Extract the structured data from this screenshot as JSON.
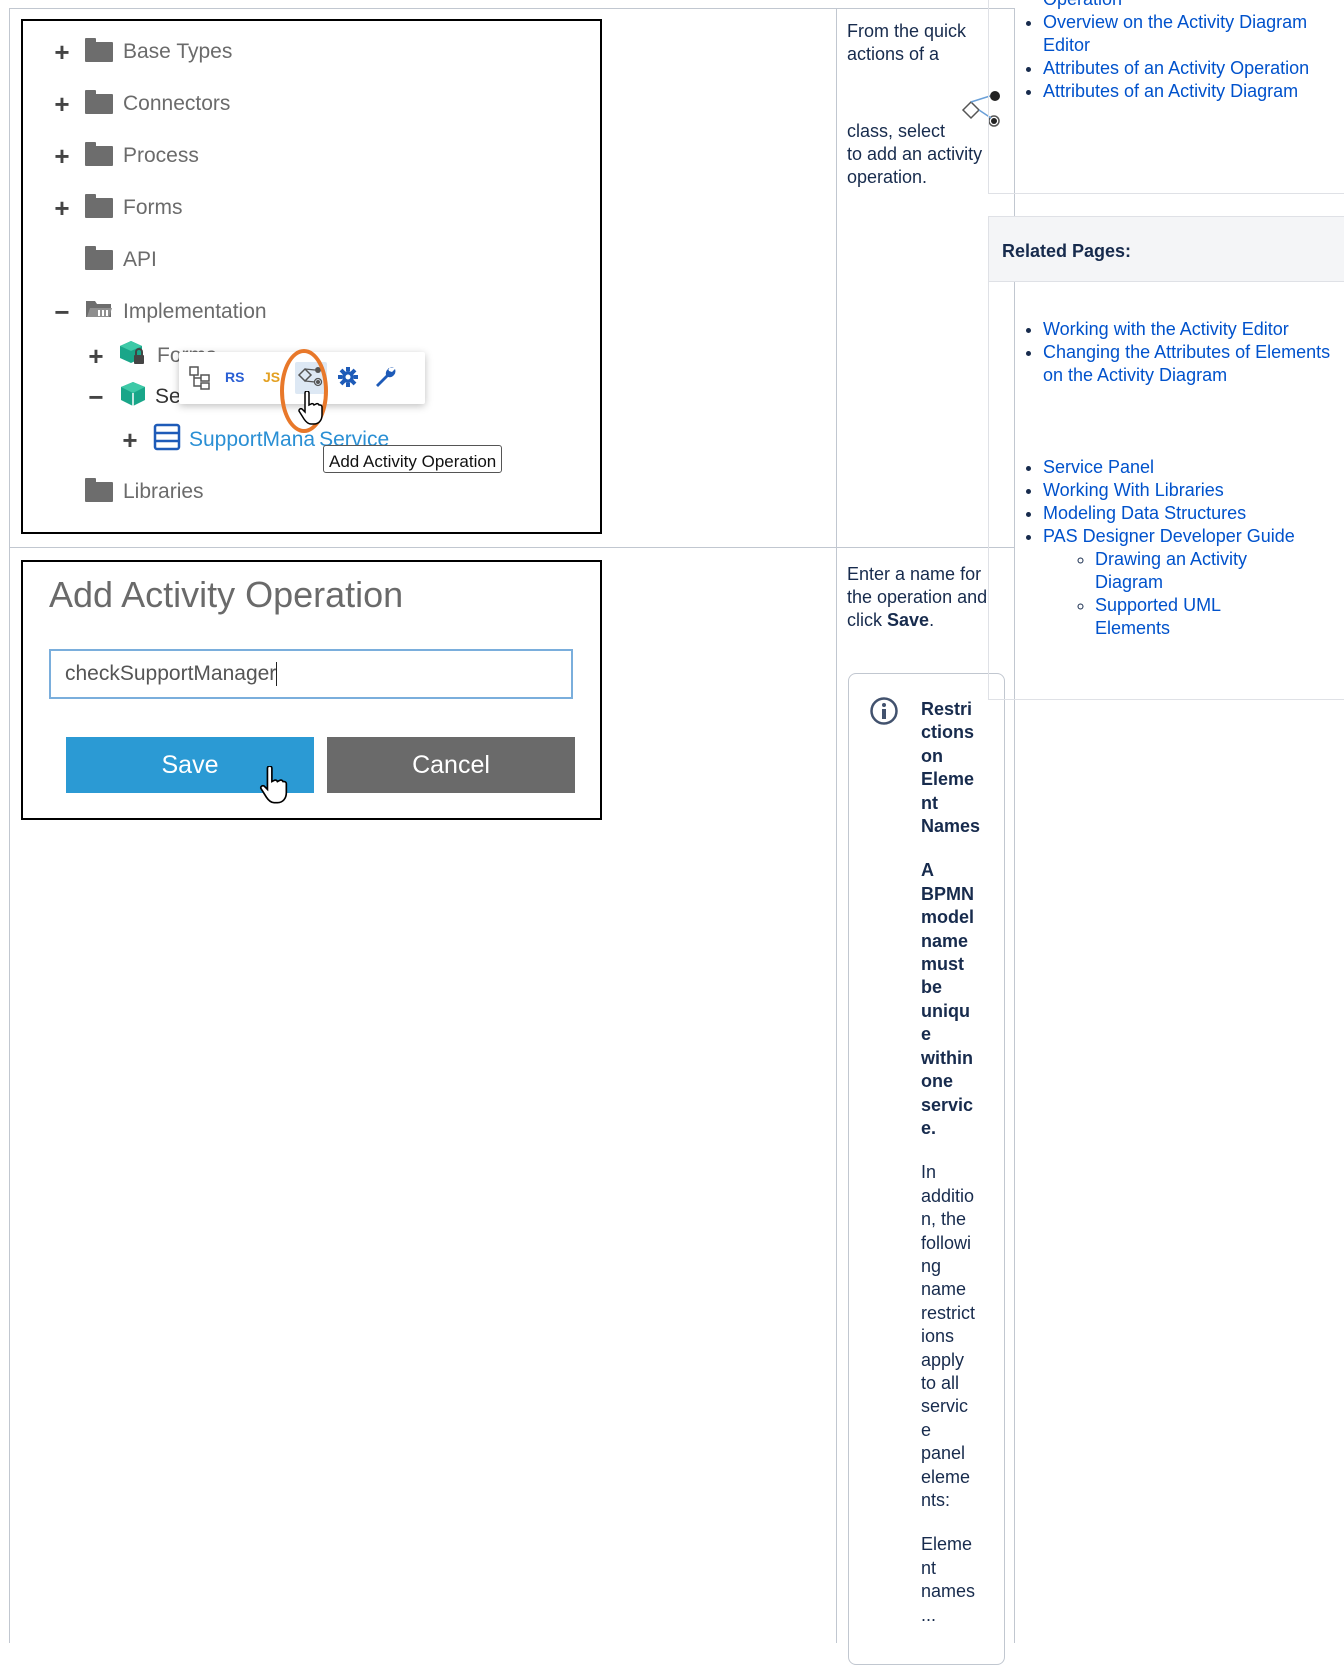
{
  "tree": {
    "items": [
      {
        "toggle": "+",
        "label": "Base Types"
      },
      {
        "toggle": "+",
        "label": "Connectors"
      },
      {
        "toggle": "+",
        "label": "Process"
      },
      {
        "toggle": "+",
        "label": "Forms"
      },
      {
        "toggle": "",
        "label": "API"
      },
      {
        "toggle": "−",
        "label": "Implementation"
      },
      {
        "toggle": "+",
        "label": "Forms"
      },
      {
        "toggle": "−",
        "label": "Ser"
      },
      {
        "toggle": "+",
        "label": "SupportMana",
        "label_tail": "Service"
      },
      {
        "toggle": "",
        "label": "Libraries"
      }
    ],
    "quick_actions": [
      "RS",
      "JS"
    ],
    "tooltip": "Add Activity Operation"
  },
  "step1": {
    "text_a": "From the quick actions of a",
    "text_b": "class, select",
    "text_c": "to add an activity operation."
  },
  "dialog": {
    "title": "Add Activity Operation",
    "input_value": "checkSupportManager",
    "save_label": "Save",
    "cancel_label": "Cancel"
  },
  "step2": {
    "text_a": "Enter a name for the operation and click",
    "text_bold": "Save",
    "text_end": "."
  },
  "note": {
    "title_lines": [
      "Restri",
      "ctions",
      "on",
      "Eleme",
      "nt",
      "Names"
    ],
    "bold_lines": [
      "A",
      "BPMN",
      "model",
      "name",
      "must",
      "be",
      "uniqu",
      "e",
      "within",
      "one",
      "servic",
      "e."
    ],
    "body_lines": [
      "In",
      "additio",
      "n, the",
      "followi",
      "ng",
      "name",
      "restrict",
      "ions",
      "apply",
      "to all",
      "servic",
      "e",
      "panel",
      "eleme",
      "nts:"
    ],
    "tail_lines": [
      "Eleme",
      "nt",
      "names",
      "..."
    ]
  },
  "sidebar": {
    "top_links": [
      {
        "text": "Operation"
      },
      {
        "text": "Overview on the Activity Diagram Editor"
      },
      {
        "text": "Attributes of an Activity Operation"
      },
      {
        "text": "Attributes of an Activity Diagram"
      }
    ],
    "related_heading": "Related Pages:",
    "group1": [
      {
        "text": "Working with the Activity Editor"
      },
      {
        "text": "Changing the Attributes of Elements on the Activity Diagram"
      }
    ],
    "group2": [
      {
        "text": "Service Panel"
      },
      {
        "text": "Working With Libraries"
      },
      {
        "text": "Modeling Data Structures"
      },
      {
        "text": "PAS Designer Developer Guide"
      }
    ],
    "subitems": [
      {
        "text": "Drawing an Activity Diagram"
      },
      {
        "text": "Supported UML Elements"
      }
    ]
  }
}
